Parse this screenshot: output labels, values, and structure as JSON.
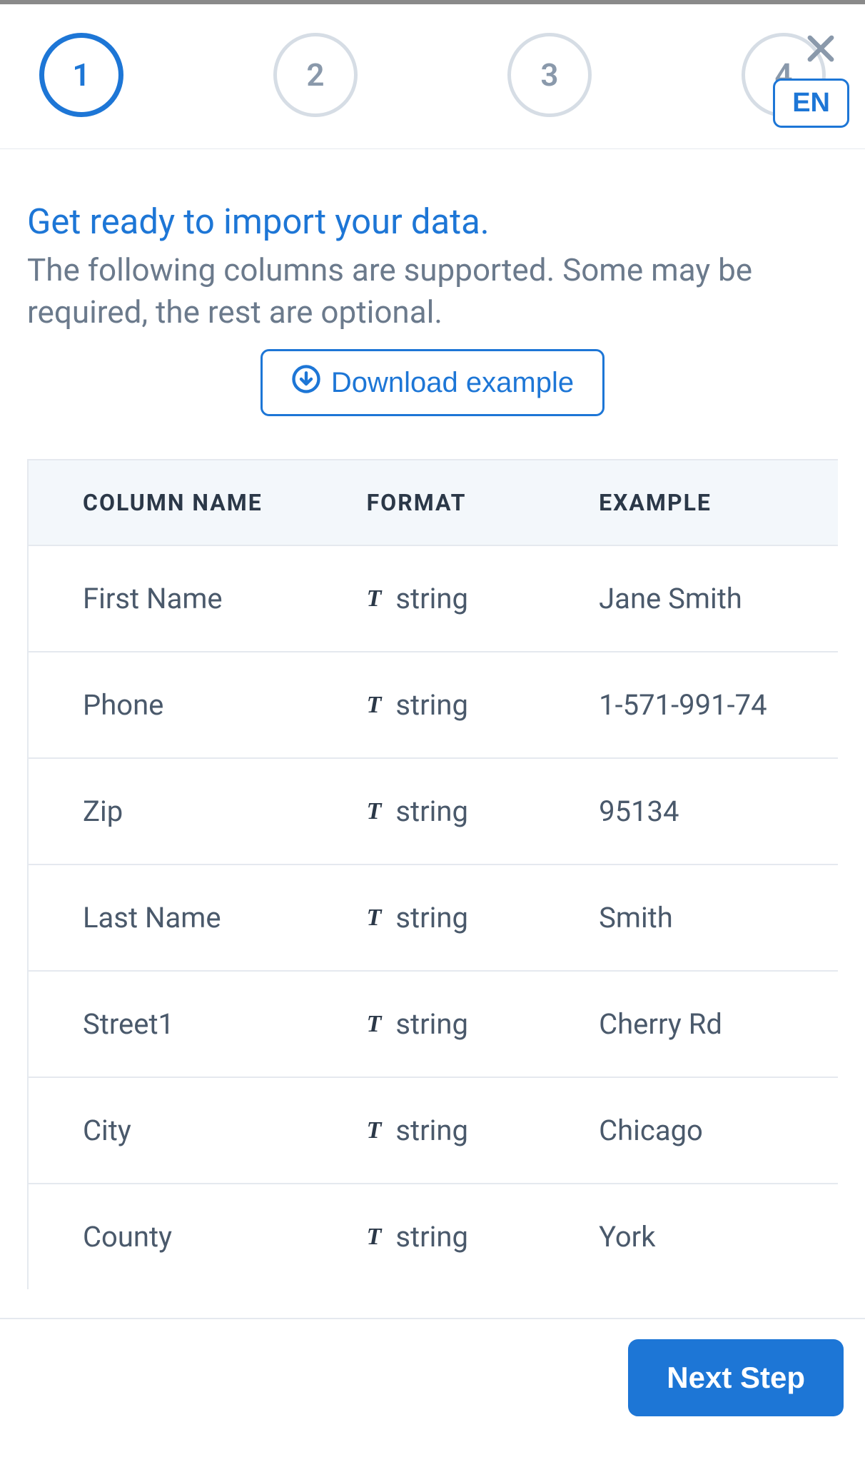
{
  "stepper": {
    "steps": [
      "1",
      "2",
      "3",
      "4"
    ],
    "active_index": 0
  },
  "lang_button": "EN",
  "heading": {
    "title": "Get ready to import your data.",
    "subtitle": "The following columns are supported. Some may be required, the rest are optional."
  },
  "download_button": "Download example",
  "table": {
    "headers": {
      "column_name": "COLUMN NAME",
      "format": "FORMAT",
      "example": "EXAMPLE"
    },
    "rows": [
      {
        "name": "First Name",
        "format": "string",
        "example": "Jane Smith"
      },
      {
        "name": "Phone",
        "format": "string",
        "example": "1-571-991-74"
      },
      {
        "name": "Zip",
        "format": "string",
        "example": "95134"
      },
      {
        "name": "Last Name",
        "format": "string",
        "example": "Smith"
      },
      {
        "name": "Street1",
        "format": "string",
        "example": "Cherry Rd"
      },
      {
        "name": "City",
        "format": "string",
        "example": "Chicago"
      },
      {
        "name": "County",
        "format": "string",
        "example": "York"
      }
    ]
  },
  "footer": {
    "next_button": "Next Step"
  }
}
